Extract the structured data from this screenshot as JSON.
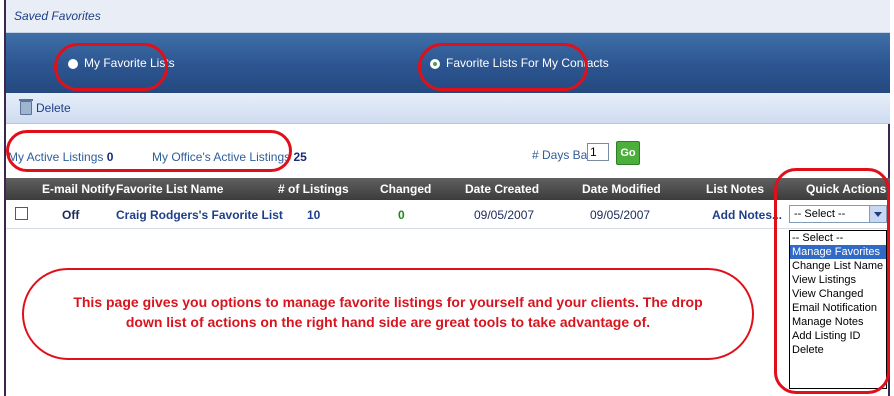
{
  "titlebar": {
    "title": "Saved Favorites"
  },
  "tabs": [
    {
      "label": "My Favorite Lists",
      "selected": false
    },
    {
      "label": "Favorite Lists For My Contacts",
      "selected": true
    }
  ],
  "toolbar": {
    "delete_label": "Delete"
  },
  "stats": {
    "my_active_label": "My Active Listings",
    "my_active_value": "0",
    "office_active_label": "My Office's Active Listings",
    "office_active_value": "25",
    "days_back_label": "# Days Back:",
    "days_back_value": "1",
    "go_label": "Go"
  },
  "table": {
    "headers": [
      "E-mail Notify",
      "Favorite List Name",
      "# of Listings",
      "Changed",
      "Date Created",
      "Date Modified",
      "List Notes",
      "Quick Actions"
    ],
    "rows": [
      {
        "email_notify": "Off",
        "list_name": "Craig Rodgers's Favorite List",
        "listings": "10",
        "changed": "0",
        "date_created": "09/05/2007",
        "date_modified": "09/05/2007",
        "notes": "Add Notes..."
      }
    ]
  },
  "quick_actions": {
    "selected": "-- Select --",
    "options": [
      "-- Select --",
      "Manage Favorites",
      "Change List Name",
      "View Listings",
      "View Changed",
      "Email Notification",
      "Manage Notes",
      "Add Listing ID",
      "Delete"
    ],
    "highlighted": "Manage Favorites"
  },
  "callout": {
    "text": "This page gives you options to manage favorite listings for yourself and your clients. The drop down list of actions on the right hand side are great tools to take advantage of."
  },
  "colors": {
    "annotation_red": "#e0101a",
    "header_blue": "#2c5590",
    "go_green": "#4cae3b",
    "changed_green": "#1a8a1a"
  }
}
